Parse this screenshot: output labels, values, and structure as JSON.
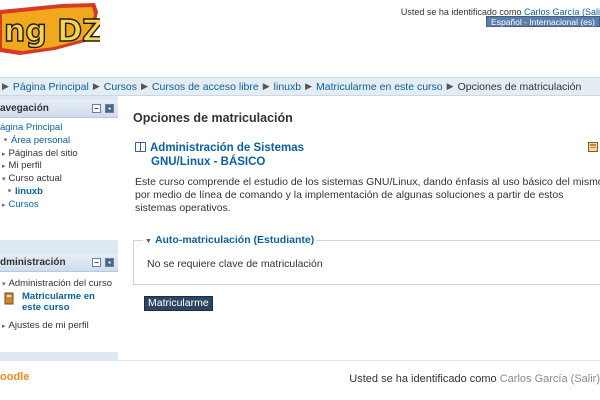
{
  "header": {
    "logo_text": "ng DZ",
    "login_prefix": "Usted se ha identificado como",
    "login_user": "Carlos García (Sali",
    "language": "Español - Internacional (es)"
  },
  "breadcrumb": {
    "items": [
      "Página Principal",
      "Cursos",
      "Cursos de acceso libre",
      "linuxb",
      "Matricularme en este curso"
    ],
    "current": "Opciones de matriculación"
  },
  "navigation": {
    "title": "avegación",
    "items": [
      "ágina Principal",
      "Área personal",
      "Páginas del sitio",
      "Mi perfil",
      "Curso actual",
      "linuxb",
      "Cursos"
    ]
  },
  "administration": {
    "title": "dministración",
    "items": [
      "Administración del curso",
      "Matricularme en",
      "este curso",
      "Ajustes de mi perfil"
    ]
  },
  "main": {
    "heading": "Opciones de matriculación",
    "course_title_line1": "Administración de Sistemas",
    "course_title_line2": "GNU/Linux - BÁSICO",
    "summary": "Este curso comprende el estudio de los sistemas GNU/Linux, dando énfasis al uso básico del mismo por medio de línea de comando y la implementación de algunas soluciones a partir de estos sistemas operativos.",
    "fieldset_legend": "Auto-matriculación (Estudiante)",
    "fieldset_message": "No se requiere clave de matriculación",
    "enrol_button": "Matricularme"
  },
  "footer": {
    "moodle": "oodle",
    "login_prefix": "Usted se ha identificado como",
    "login_user": "Carlos García",
    "login_suffix": "(Salir)"
  }
}
